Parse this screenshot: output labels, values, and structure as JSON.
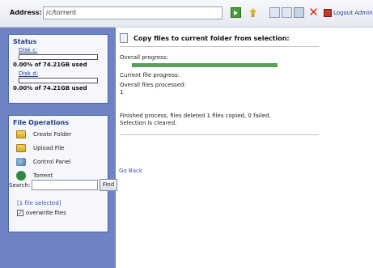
{
  "address": {
    "label": "Address:",
    "value": "/c/torrent"
  },
  "toolbar": {
    "logout_label": "Logout Admin"
  },
  "sidebar": {
    "status": {
      "title": "Status",
      "disks": [
        {
          "label": "Disk c:",
          "used_text": "0.00% of 74.21GB  used",
          "used_fraction": 0.0
        },
        {
          "label": "Disk d:",
          "used_text": "0.00% of 74.21GB  used",
          "used_fraction": 0.0
        }
      ]
    },
    "file_operations": {
      "title": "File Operations",
      "items": [
        {
          "label": "Create Folder",
          "icon": "folder-icon"
        },
        {
          "label": "Upload File",
          "icon": "upload-folder-icon"
        },
        {
          "label": "Control Panel",
          "icon": "control-panel-icon"
        },
        {
          "label": "Torrent",
          "icon": "torrent-icon"
        }
      ]
    },
    "search": {
      "label": "Search:",
      "value": "",
      "button": "Find"
    },
    "selection_note": "[1 file selected]",
    "overwrite": {
      "label": "overwrite files",
      "checked": true
    }
  },
  "main": {
    "title": "Copy files to current folder from selection:",
    "overall_progress_label": "Overall progress:",
    "overall_progress_value": 1.0,
    "current_progress_label": "Current file progress:",
    "files_processed_label": "Overall files processed:",
    "files_processed_value": "1",
    "result_line1": "Finished process, files deleted 1 files copied, 0 failed.",
    "result_line2": "Selection is cleared.",
    "go_back": "Go Back"
  },
  "colors": {
    "sidebar_bg": "#6e82c4",
    "progress_fill": "#5a9e58",
    "link": "#3a56a6"
  }
}
